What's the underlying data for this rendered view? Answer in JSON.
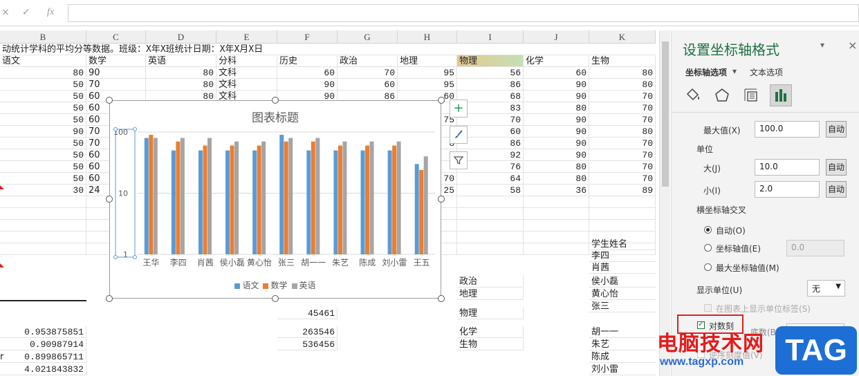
{
  "formula_bar": {
    "cancel_icon": "×",
    "confirm_icon": "✓",
    "fx_label": "fx",
    "value": ""
  },
  "columns": [
    "B",
    "C",
    "D",
    "E",
    "F",
    "G",
    "H",
    "I",
    "J",
    "K"
  ],
  "sheet": {
    "title_row": "动统计学科的平均分等数据。班级：X年X班统计日期：X年X月X日",
    "headers": [
      "语文",
      "数学",
      "英语",
      "分科",
      "历史",
      "政治",
      "地理",
      "物理",
      "化学",
      "生物"
    ],
    "rows": [
      [
        "80",
        "90",
        "80",
        "文科",
        "60",
        "70",
        "95",
        "56",
        "60",
        "80"
      ],
      [
        "50",
        "70",
        "80",
        "文科",
        "90",
        "60",
        "95",
        "86",
        "90",
        "80"
      ],
      [
        "50",
        "60",
        "80",
        "文科",
        "90",
        "86",
        "60",
        "68",
        "90",
        "70"
      ],
      [
        "50",
        "60",
        "",
        "",
        "",
        "",
        "6",
        "83",
        "80",
        "70"
      ],
      [
        "50",
        "60",
        "",
        "",
        "",
        "",
        "75",
        "70",
        "90",
        "70"
      ],
      [
        "90",
        "70",
        "",
        "",
        "",
        "",
        "8",
        "60",
        "90",
        "80"
      ],
      [
        "50",
        "70",
        "",
        "",
        "",
        "",
        "8",
        "86",
        "90",
        "70"
      ],
      [
        "50",
        "60",
        "",
        "",
        "",
        "",
        "8",
        "92",
        "90",
        "70"
      ],
      [
        "50",
        "60",
        "",
        "",
        "",
        "",
        "6",
        "76",
        "80",
        "70"
      ],
      [
        "50",
        "60",
        "",
        "",
        "",
        "",
        "70",
        "64",
        "80",
        "70"
      ],
      [
        "30",
        "24",
        "",
        "",
        "",
        "",
        "25",
        "58",
        "36",
        "89"
      ]
    ],
    "k_list": [
      "学生姓名",
      "李四",
      "肖茜",
      "侯小磊",
      "黄心怡",
      "张三",
      "胡一一",
      "朱艺",
      "陈成",
      "刘小雷"
    ],
    "i_list": [
      "政治",
      "地理",
      "物理",
      "化学",
      "生物"
    ],
    "f_values": [
      "45461",
      "263546",
      "536456"
    ],
    "b_values": [
      "0.953875851",
      "0.90987914",
      "0.899865711",
      "4.021843832"
    ],
    "a_fragment": "r"
  },
  "chart_data": {
    "type": "bar",
    "title": "图表标题",
    "categories": [
      "王华",
      "李四",
      "肖茜",
      "侯小磊",
      "黄心怡",
      "张三",
      "胡一一",
      "朱艺",
      "陈成",
      "刘小雷",
      "王五"
    ],
    "series": [
      {
        "name": "语文",
        "values": [
          80,
          50,
          50,
          50,
          50,
          90,
          50,
          50,
          50,
          50,
          30
        ],
        "color": "#5b9bd5"
      },
      {
        "name": "数学",
        "values": [
          90,
          70,
          60,
          60,
          60,
          70,
          70,
          60,
          60,
          60,
          24
        ],
        "color": "#ed7d31"
      },
      {
        "name": "英语",
        "values": [
          80,
          80,
          80,
          70,
          70,
          80,
          80,
          70,
          70,
          70,
          40
        ],
        "color": "#a5a5a5"
      }
    ],
    "ylim": [
      1,
      100
    ],
    "yscale": "log",
    "yticks": [
      "1",
      "10",
      "100"
    ],
    "legend_position": "bottom",
    "grid": true
  },
  "chart_buttons": {
    "add_icon": "+",
    "style_icon": "brush",
    "filter_icon": "filter"
  },
  "pane": {
    "title": "设置坐标轴格式",
    "tab_axis_options": "坐标轴选项",
    "tab_text_options": "文本选项",
    "max_label": "最大值(X)",
    "max_value": "100.0",
    "auto_label": "自动",
    "unit_label": "单位",
    "major_label": "大(J)",
    "major_value": "10.0",
    "minor_label": "小(I)",
    "minor_value": "2.0",
    "cross_label": "横坐标轴交叉",
    "cross_auto": "自动(O)",
    "cross_value": "坐标轴值(E)",
    "cross_value_input": "0.0",
    "cross_max": "最大坐标轴值(M)",
    "display_unit_label": "显示单位(U)",
    "display_unit_value": "无",
    "show_unit_label": "在图表上显示单位标签(S)",
    "log_label": "对数刻",
    "base_label": "底数(B)",
    "base_value": "10",
    "reverse_label": "逆序刻度值(V)",
    "accent": "#1e7145"
  },
  "watermark": {
    "text": "电脑技术网",
    "url": "www.tagxp.com",
    "tag": "TAG"
  }
}
